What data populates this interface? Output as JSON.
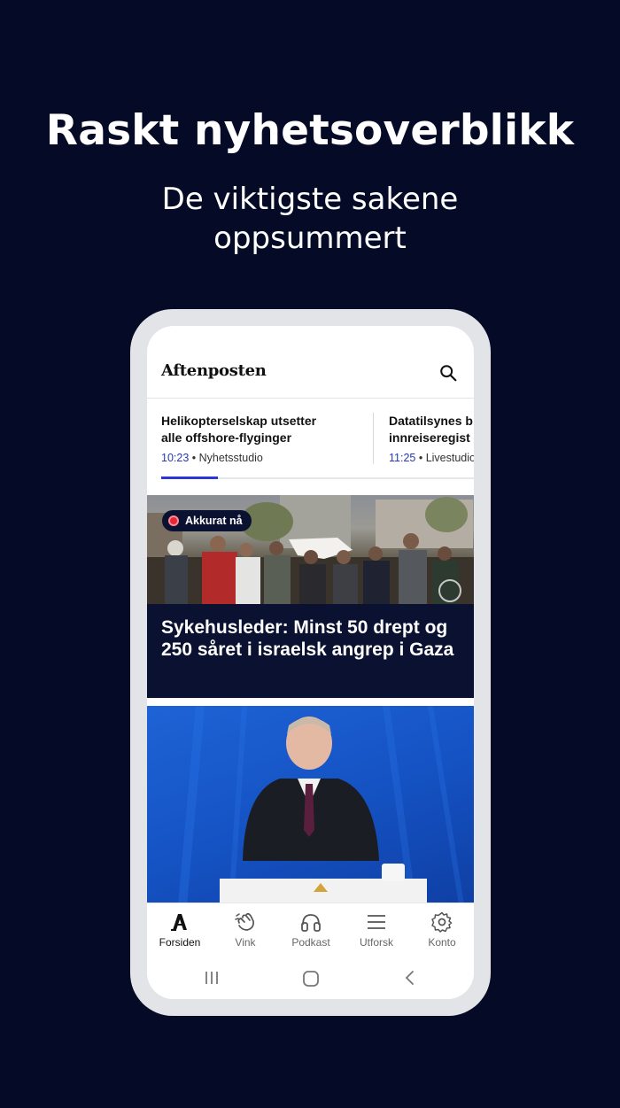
{
  "promo": {
    "headline": "Raskt nyhetsoverblikk",
    "subline_1": "De viktigste sakene",
    "subline_2": "oppsummert"
  },
  "app": {
    "logo": "Aftenposten",
    "search_icon": "search-icon",
    "ticker": [
      {
        "title_1": "Helikopterselskap utsetter",
        "title_2": "alle offshore-flyginger",
        "time": "10:23",
        "source": "Nyhetsstudio"
      },
      {
        "title_1": "Datatilsynes b",
        "title_2": "innreiseregist",
        "time": "11:25",
        "source": "Livestudio"
      }
    ],
    "ticker_progress": 0.18,
    "live_card": {
      "badge": "Akkurat nå",
      "title": "Sykehusleder: Minst 50 drept og 250 såret i israelsk angrep i Gaza"
    },
    "nav": [
      {
        "label": "Forsiden",
        "icon": "aftenposten-a-icon",
        "active": true
      },
      {
        "label": "Vink",
        "icon": "vink-hand-icon",
        "active": false
      },
      {
        "label": "Podkast",
        "icon": "headphones-icon",
        "active": false
      },
      {
        "label": "Utforsk",
        "icon": "menu-lines-icon",
        "active": false
      },
      {
        "label": "Konto",
        "icon": "gear-icon",
        "active": false
      }
    ],
    "system_nav": [
      "recents-icon",
      "home-icon",
      "back-icon"
    ]
  },
  "colors": {
    "background": "#050b26",
    "accent": "#2b35d8",
    "live_red": "#e2283a",
    "card_dark": "#0b1130"
  }
}
